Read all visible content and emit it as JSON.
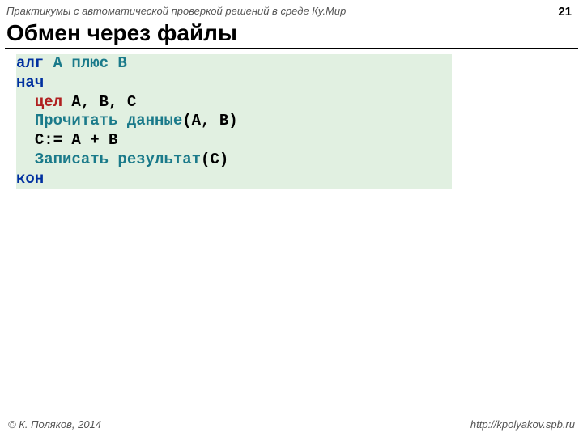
{
  "header": {
    "subject": "Практикумы с автоматической проверкой решений в среде Ку.Мир",
    "page": "21"
  },
  "title": "Обмен через файлы",
  "code": {
    "l1": {
      "kw": "алг",
      "name": " A плюс B"
    },
    "l2": {
      "kw": "нач"
    },
    "l3": {
      "indent": "  ",
      "type": "цел",
      "rest": " A, B, C"
    },
    "l4": {
      "indent": "  ",
      "call": "Прочитать данные",
      "rest": "(A, B)"
    },
    "l5": {
      "indent": "  ",
      "rest": "C:= A + B"
    },
    "l6": {
      "indent": "  ",
      "call": "Записать результат",
      "rest": "(C)"
    },
    "l7": {
      "kw": "кон"
    }
  },
  "footer": {
    "copyright": "© К. Поляков, 2014",
    "url": "http://kpolyakov.spb.ru"
  }
}
